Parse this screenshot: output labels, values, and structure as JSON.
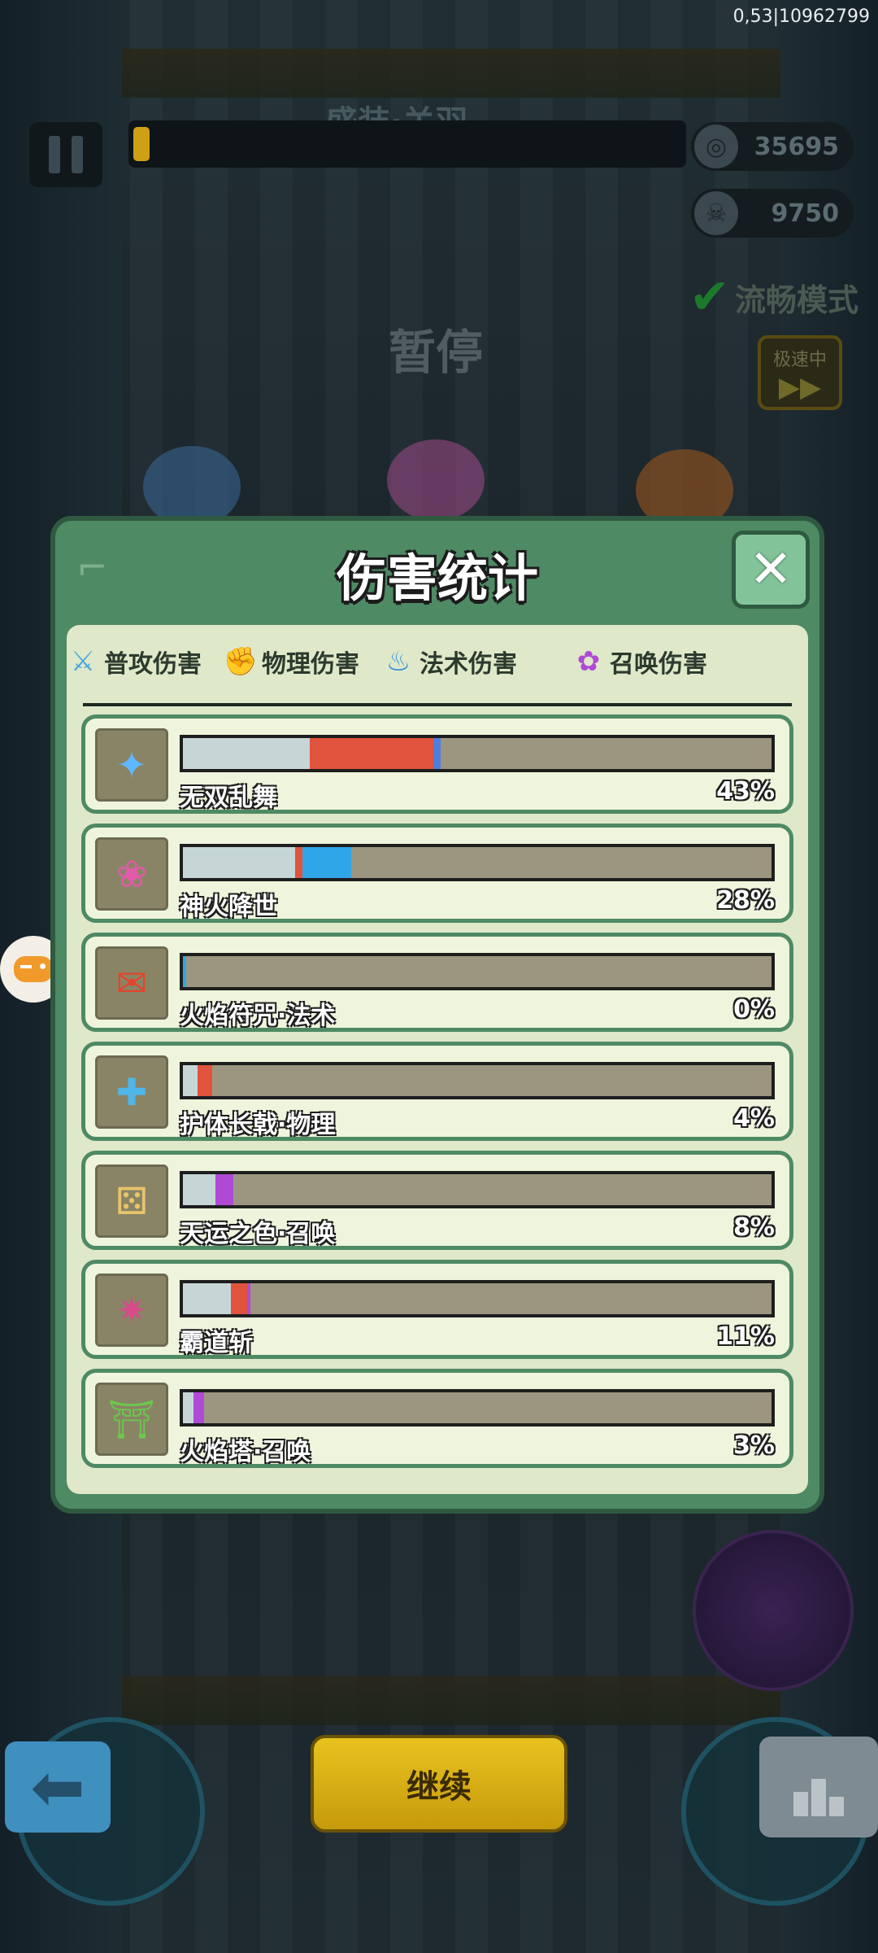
{
  "status": {
    "top_right": "0,53|10962799"
  },
  "hud": {
    "boss_name": "盛装·关羽",
    "boss_hp_fraction": 0.03,
    "coins": "35695",
    "kills": "9750",
    "smooth_mode": "流畅模式",
    "paused_label": "暂停",
    "speed_label": "极速中",
    "speed_arrow": "▶▶"
  },
  "modal": {
    "title": "伤害统计",
    "close_symbol": "✕",
    "tabs": [
      {
        "label": "普攻伤害",
        "icon": "sword-icon",
        "color": "#4aa8e0"
      },
      {
        "label": "物理伤害",
        "icon": "fist-icon",
        "color": "#d63a3a"
      },
      {
        "label": "法术伤害",
        "icon": "flame-icon",
        "color": "#2d8fe0"
      },
      {
        "label": "召唤伤害",
        "icon": "paw-icon",
        "color": "#b04ad6"
      }
    ],
    "rows": [
      {
        "name": "无双乱舞",
        "percent": "43%",
        "icon": "blade-storm-icon",
        "icon_char": "✦",
        "icon_color": "#5fb8ff",
        "segments": [
          {
            "value": 0.215,
            "color": "#c6d6d6"
          },
          {
            "value": 0.21,
            "color": "#e0533c"
          },
          {
            "value": 0.012,
            "color": "#4f7de0"
          }
        ]
      },
      {
        "name": "神火降世",
        "percent": "28%",
        "icon": "divine-fire-icon",
        "icon_char": "❀",
        "icon_color": "#e25aa8",
        "segments": [
          {
            "value": 0.19,
            "color": "#c6d6d6"
          },
          {
            "value": 0.012,
            "color": "#e0533c"
          },
          {
            "value": 0.083,
            "color": "#2fa6e8"
          }
        ]
      },
      {
        "name": "火焰符咒·法术",
        "percent": "0%",
        "icon": "flame-scroll-icon",
        "icon_char": "✉",
        "icon_color": "#e2442a",
        "segments": [
          {
            "value": 0.006,
            "color": "#2fa6e8"
          }
        ]
      },
      {
        "name": "护体长戟·物理",
        "percent": "4%",
        "icon": "halberd-icon",
        "icon_char": "✚",
        "icon_color": "#4fb6e8",
        "segments": [
          {
            "value": 0.025,
            "color": "#c6d6d6"
          },
          {
            "value": 0.025,
            "color": "#e0533c"
          }
        ]
      },
      {
        "name": "天运之色·召唤",
        "percent": "8%",
        "icon": "dice-icon",
        "icon_char": "⚄",
        "icon_color": "#e8c46a",
        "segments": [
          {
            "value": 0.055,
            "color": "#c6d6d6"
          },
          {
            "value": 0.03,
            "color": "#b04ad6"
          }
        ]
      },
      {
        "name": "霸道斩",
        "percent": "11%",
        "icon": "dragon-slash-icon",
        "icon_char": "✷",
        "icon_color": "#d84a8a",
        "segments": [
          {
            "value": 0.082,
            "color": "#c6d6d6"
          },
          {
            "value": 0.028,
            "color": "#e0533c"
          },
          {
            "value": 0.006,
            "color": "#b04ad6"
          }
        ]
      },
      {
        "name": "火焰塔·召唤",
        "percent": "3%",
        "icon": "fire-tower-icon",
        "icon_char": "⛩",
        "icon_color": "#6ac94a",
        "segments": [
          {
            "value": 0.018,
            "color": "#c6d6d6"
          },
          {
            "value": 0.018,
            "color": "#b04ad6"
          }
        ]
      }
    ]
  },
  "bottom": {
    "back_symbol": "⬅",
    "continue_label": "继续"
  }
}
